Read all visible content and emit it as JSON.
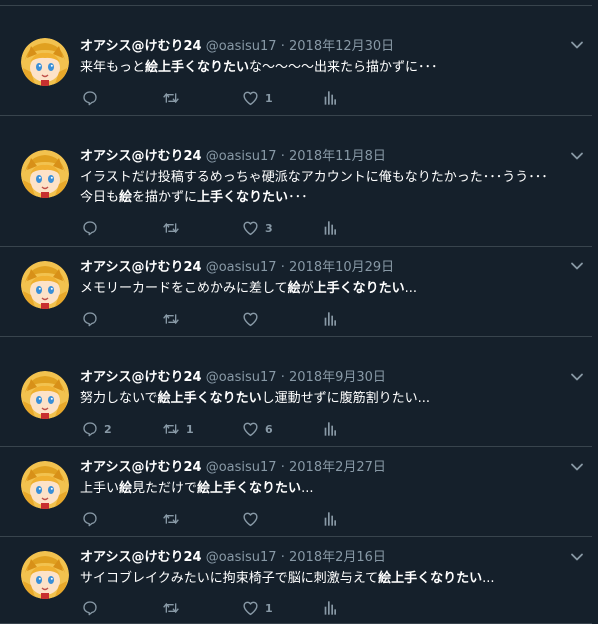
{
  "tweets": [
    {
      "name": "オアシス@けむり24",
      "handle": "@oasisu17",
      "sep": "·",
      "date": "2018年12月30日",
      "segments": [
        {
          "t": "来年もっと"
        },
        {
          "t": "絵上手くなりたい",
          "b": true
        },
        {
          "t": "な〜〜〜〜出来たら描かずに･･･"
        }
      ],
      "reply_count": "",
      "retweet_count": "",
      "like_count": "1"
    },
    {
      "name": "オアシス@けむり24",
      "handle": "@oasisu17",
      "sep": "·",
      "date": "2018年11月8日",
      "segments": [
        {
          "t": "イラストだけ投稿するめっちゃ硬派なアカウントに俺もなりたかった･･･うう･･･"
        },
        {
          "br": true
        },
        {
          "t": "今日も"
        },
        {
          "t": "絵",
          "b": true
        },
        {
          "t": "を描かずに"
        },
        {
          "t": "上手くなりたい",
          "b": true
        },
        {
          "t": "･･･"
        }
      ],
      "reply_count": "",
      "retweet_count": "",
      "like_count": "3"
    },
    {
      "name": "オアシス@けむり24",
      "handle": "@oasisu17",
      "sep": "·",
      "date": "2018年10月29日",
      "segments": [
        {
          "t": "メモリーカードをこめかみに差して"
        },
        {
          "t": "絵",
          "b": true
        },
        {
          "t": "が"
        },
        {
          "t": "上手くなりたい",
          "b": true
        },
        {
          "t": "..."
        }
      ],
      "reply_count": "",
      "retweet_count": "",
      "like_count": ""
    },
    {
      "name": "オアシス@けむり24",
      "handle": "@oasisu17",
      "sep": "·",
      "date": "2018年9月30日",
      "segments": [
        {
          "t": "努力しないで"
        },
        {
          "t": "絵上手くなりたい",
          "b": true
        },
        {
          "t": "し運動せずに腹筋割りたい..."
        }
      ],
      "reply_count": "2",
      "retweet_count": "1",
      "like_count": "6"
    },
    {
      "name": "オアシス@けむり24",
      "handle": "@oasisu17",
      "sep": "·",
      "date": "2018年2月27日",
      "segments": [
        {
          "t": "上手い"
        },
        {
          "t": "絵",
          "b": true
        },
        {
          "t": "見ただけで"
        },
        {
          "t": "絵上手くなりたい",
          "b": true
        },
        {
          "t": "..."
        }
      ],
      "reply_count": "",
      "retweet_count": "",
      "like_count": ""
    },
    {
      "name": "オアシス@けむり24",
      "handle": "@oasisu17",
      "sep": "·",
      "date": "2018年2月16日",
      "segments": [
        {
          "t": "サイコブレイクみたいに拘束椅子で脳に刺激与えて"
        },
        {
          "t": "絵上手くなりたい",
          "b": true
        },
        {
          "t": "..."
        }
      ],
      "reply_count": "",
      "retweet_count": "",
      "like_count": "1"
    }
  ],
  "colors": {
    "background": "#15202b",
    "divider": "#38444d",
    "secondary_text": "#8899a6",
    "primary_text": "#ffffff"
  },
  "icons": {
    "reply": "reply-icon",
    "retweet": "retweet-icon",
    "like": "heart-icon",
    "analytics": "analytics-icon",
    "caret": "chevron-down-icon"
  }
}
